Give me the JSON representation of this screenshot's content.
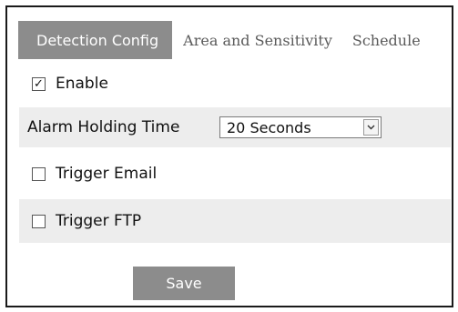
{
  "tabs": [
    {
      "label": "Detection Config",
      "active": true
    },
    {
      "label": "Area and Sensitivity",
      "active": false
    },
    {
      "label": "Schedule",
      "active": false
    }
  ],
  "enable": {
    "label": "Enable",
    "checked": true,
    "check_glyph": "✓"
  },
  "alarm_holding_time": {
    "label": "Alarm Holding Time",
    "selected": "20 Seconds"
  },
  "trigger_email": {
    "label": "Trigger Email",
    "checked": false
  },
  "trigger_ftp": {
    "label": "Trigger FTP",
    "checked": false
  },
  "save_label": "Save",
  "colors": {
    "tab_active_bg": "#8c8c8c",
    "row_shade": "#ededed",
    "button_bg": "#8c8c8c",
    "frame_border": "#1a1a1a"
  },
  "icons": {
    "select_arrow": "chevron-down-icon",
    "checkmark": "checkmark-icon"
  }
}
